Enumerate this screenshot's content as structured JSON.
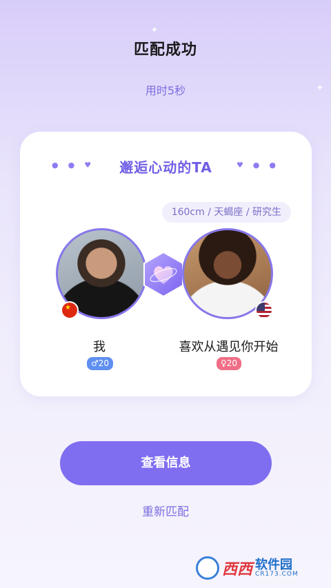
{
  "header": {
    "title": "匹配成功",
    "subtitle": "用时5秒"
  },
  "card": {
    "heading": "邂逅心动的TA",
    "info_pill": "160cm / 天蝎座 / 研究生",
    "left_user": {
      "name": "我",
      "gender_tag": "♂20",
      "flag_icon": "china-flag-icon"
    },
    "right_user": {
      "name": "喜欢从遇见你开始",
      "gender_tag": "♀20",
      "flag_icon": "usa-flag-icon"
    },
    "match_icon": "heart-icon"
  },
  "actions": {
    "primary_label": "查看信息",
    "secondary_label": "重新匹配"
  },
  "watermark": {
    "brand": "西西",
    "name": "软件园",
    "url": "CR173.COM"
  },
  "colors": {
    "accent": "#7f6ef0",
    "male_tag": "#5f8ff0",
    "female_tag": "#f06e86"
  }
}
